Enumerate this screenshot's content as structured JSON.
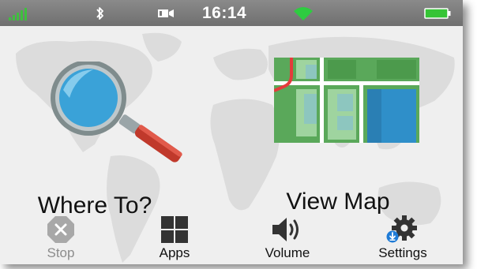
{
  "status_bar": {
    "time": "16:14",
    "icons": [
      "signal-bars-icon",
      "bluetooth-icon",
      "camera-icon",
      "wifi-icon",
      "battery-icon"
    ],
    "colors": {
      "bar": "#7a7a7a",
      "signal": "#3fbf3f",
      "wifi": "#2ecc40",
      "battery": "#35c435"
    }
  },
  "tiles": {
    "where_to": {
      "label": "Where To?",
      "icon": "magnifier-icon"
    },
    "view_map": {
      "label": "View Map",
      "icon": "map-icon"
    }
  },
  "bottom_bar": {
    "stop": {
      "label": "Stop",
      "icon": "stop-icon",
      "enabled": false
    },
    "apps": {
      "label": "Apps",
      "icon": "apps-grid-icon"
    },
    "volume": {
      "label": "Volume",
      "icon": "speaker-icon"
    },
    "settings": {
      "label": "Settings",
      "icon": "gear-icon",
      "badge_icon": "download-badge-icon"
    }
  }
}
